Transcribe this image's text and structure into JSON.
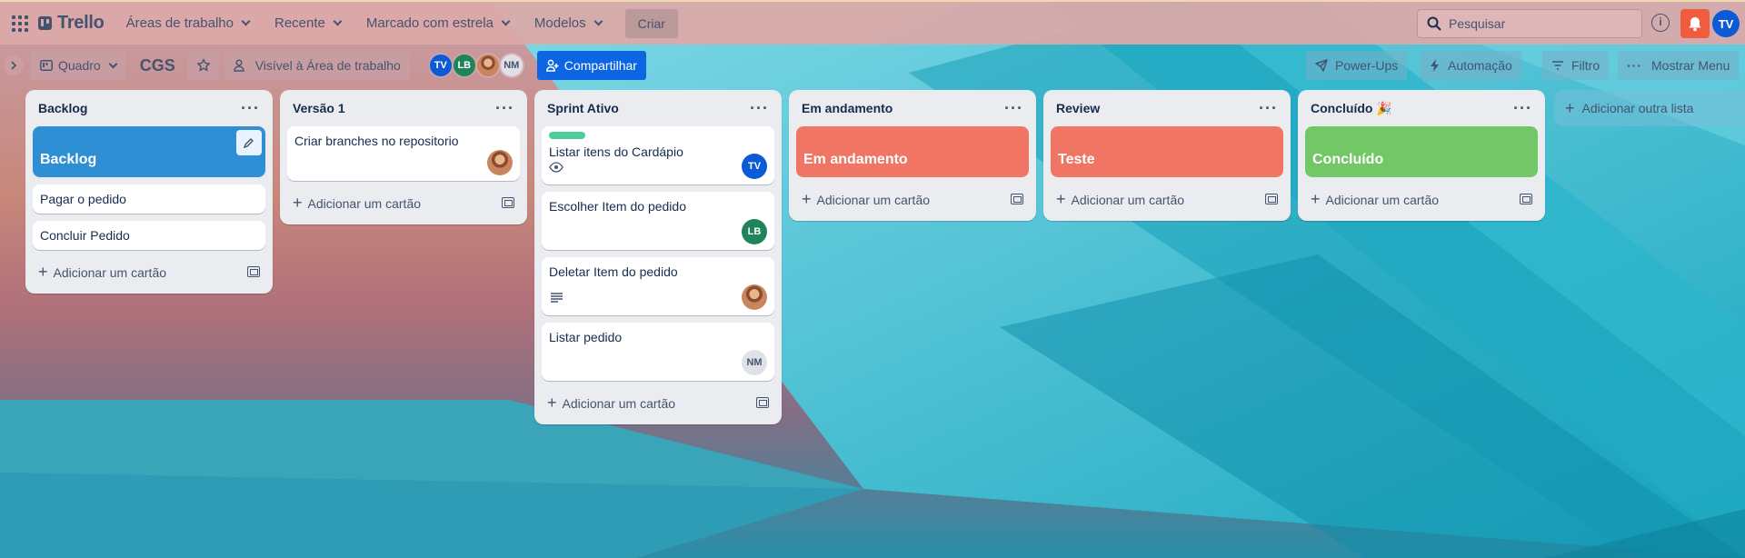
{
  "app": {
    "name": "Trello"
  },
  "topnav": {
    "workspaces": "Áreas de trabalho",
    "recent": "Recente",
    "starred": "Marcado com estrela",
    "templates": "Modelos",
    "create": "Criar",
    "search_placeholder": "Pesquisar",
    "avatar": "TV"
  },
  "board": {
    "view": "Quadro",
    "title": "CGS",
    "visibility": "Visível à Área de trabalho",
    "share": "Compartilhar",
    "powerups": "Power-Ups",
    "automation": "Automação",
    "filter": "Filtro",
    "menu": "Mostrar Menu",
    "members": [
      {
        "initials": "TV",
        "color": "#0c5ad6"
      },
      {
        "initials": "LB",
        "color": "#1f845a"
      },
      {
        "initials": "",
        "color": "photo"
      },
      {
        "initials": "NM",
        "color": "#dfe1e6"
      }
    ]
  },
  "lists": [
    {
      "title": "Backlog",
      "cover": {
        "text": "Backlog",
        "color": "#2f8fd4"
      },
      "cards": [
        {
          "title": "Pagar o pedido"
        },
        {
          "title": "Concluir Pedido"
        }
      ],
      "add": "Adicionar um cartão"
    },
    {
      "title": "Versão 1",
      "cards": [
        {
          "title": "Criar branches no repositorio",
          "member": "photo"
        }
      ],
      "add": "Adicionar um cartão"
    },
    {
      "title": "Sprint Ativo",
      "cards": [
        {
          "title": "Listar itens do Cardápio",
          "label": "#4bce97",
          "watch": true,
          "member": "TV"
        },
        {
          "title": "Escolher Item do pedido",
          "member": "LB"
        },
        {
          "title": "Deletar Item do pedido",
          "desc": true,
          "member": "photo"
        },
        {
          "title": "Listar pedido",
          "member": "NM"
        }
      ],
      "add": "Adicionar um cartão"
    },
    {
      "title": "Em andamento",
      "cover": {
        "text": "Em andamento",
        "color": "#f07565"
      },
      "cards": [],
      "add": "Adicionar um cartão"
    },
    {
      "title": "Review",
      "cover": {
        "text": "Teste",
        "color": "#f07565"
      },
      "cards": [],
      "add": "Adicionar um cartão"
    },
    {
      "title": "Concluído 🎉",
      "cover": {
        "text": "Concluído",
        "color": "#73c766"
      },
      "cards": [],
      "add": "Adicionar um cartão"
    }
  ],
  "addlist": "Adicionar outra lista"
}
